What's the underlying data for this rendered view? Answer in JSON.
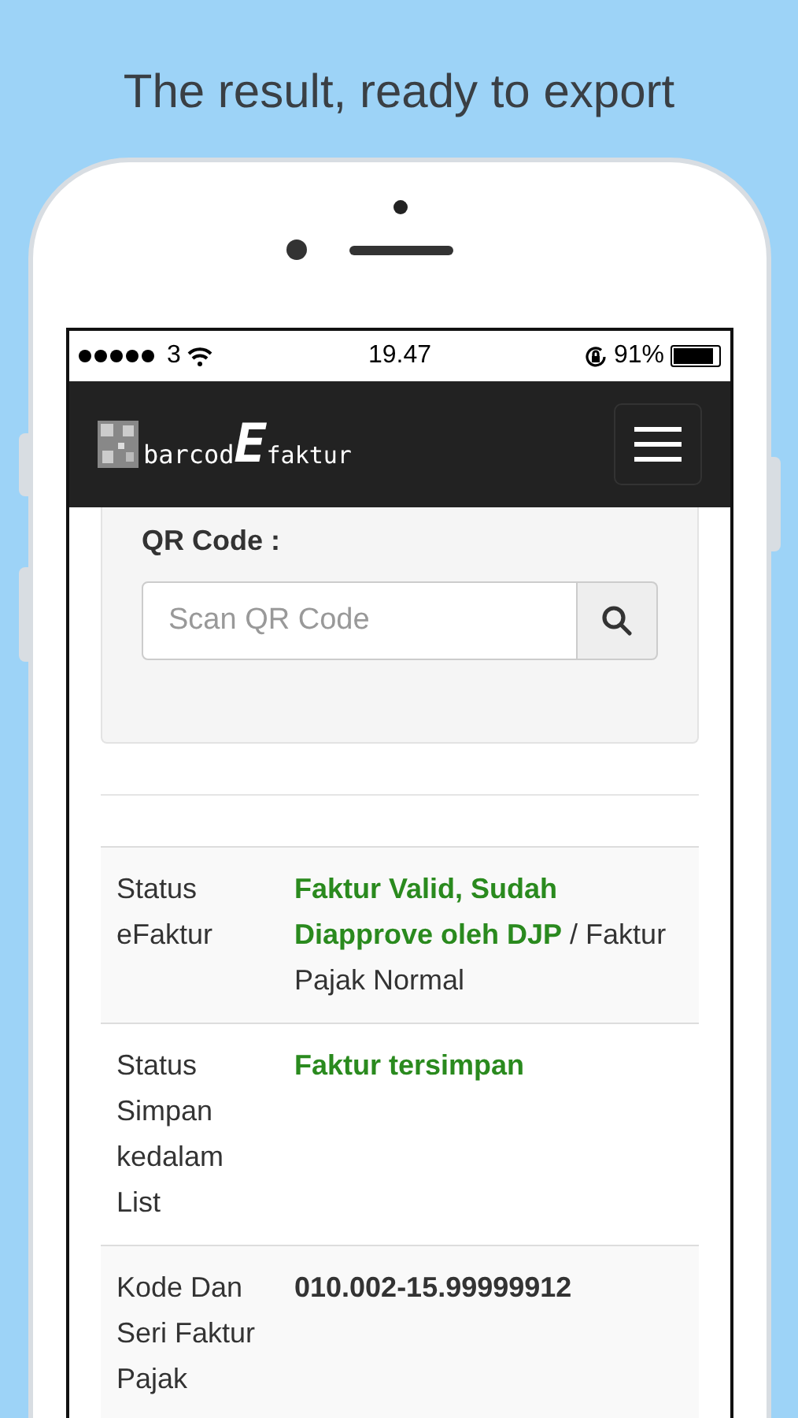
{
  "caption": "The result, ready to export",
  "status_bar": {
    "carrier": "3",
    "time": "19.47",
    "battery": "91%"
  },
  "navbar": {
    "logo_text": "barcod",
    "logo_big": "E",
    "logo_sub": "faktur"
  },
  "form": {
    "label": "QR Code :",
    "placeholder": "Scan QR Code"
  },
  "results": [
    {
      "label": "Status eFaktur",
      "value": [
        {
          "text": "Faktur Valid, Sudah Diapprove oleh DJP",
          "color": "#2a8a1e"
        },
        {
          "text": " / Faktur Pajak Normal",
          "color": "#333333"
        }
      ]
    },
    {
      "label": "Status Simpan kedalam List",
      "value": [
        {
          "text": "Faktur tersimpan",
          "color": "#2a8a1e"
        }
      ]
    },
    {
      "label": "Kode Dan Seri Faktur Pajak",
      "value": [
        {
          "text": "010.002-15.99999912",
          "color": "#333333"
        }
      ]
    }
  ]
}
